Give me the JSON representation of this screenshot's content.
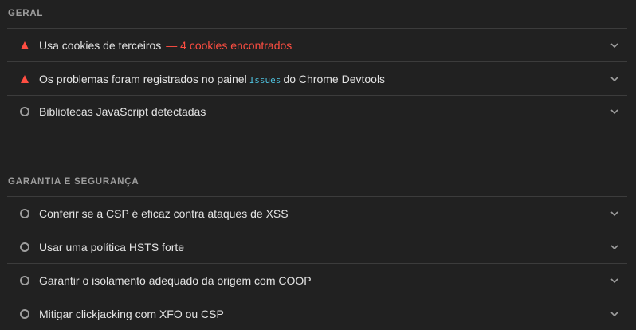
{
  "sections": {
    "geral": {
      "title": "GERAL",
      "items": [
        {
          "label": "Usa cookies de terceiros",
          "warning": "— 4 cookies encontrados"
        },
        {
          "label_before": "Os problemas foram registrados no painel",
          "code": "Issues",
          "label_after": "do Chrome Devtools"
        },
        {
          "label": "Bibliotecas JavaScript detectadas"
        }
      ]
    },
    "seguranca": {
      "title": "GARANTIA E SEGURANÇA",
      "items": [
        {
          "label": "Conferir se a CSP é eficaz contra ataques de XSS"
        },
        {
          "label": "Usar uma política HSTS forte"
        },
        {
          "label": "Garantir o isolamento adequado da origem com COOP"
        },
        {
          "label": "Mitigar clickjacking com XFO ou CSP"
        }
      ]
    }
  },
  "colors": {
    "background": "#212121",
    "fail": "#ff4e42",
    "neutral": "#9e9e9e",
    "code": "#4fc3e0"
  },
  "icons": {
    "fail": "warning-triangle-icon",
    "neutral": "circle-icon",
    "expand": "chevron-down-icon"
  }
}
